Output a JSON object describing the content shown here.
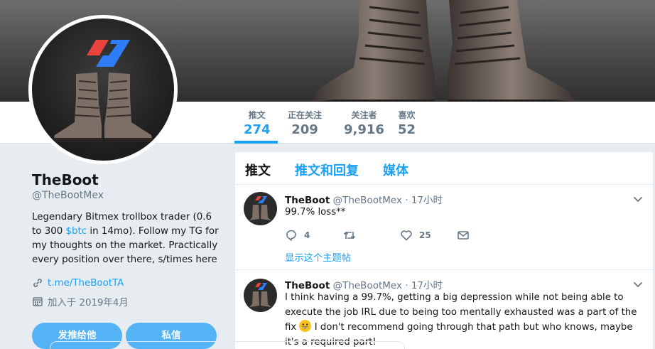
{
  "profile": {
    "name": "TheBoot",
    "handle": "@TheBootMex",
    "bio_before": "Legendary Bitmex trollbox trader (0.6 to 300 ",
    "bio_tag": "$btc",
    "bio_after": " in 14mo). Follow my TG for my thoughts on the market. Practically every position over there, s/times here",
    "link": "t.me/TheBootTA",
    "joined": "加入于 2019年4月",
    "tweet_to_label": "发推给他",
    "message_label": "私信"
  },
  "stats": [
    {
      "label": "推文",
      "value": "274"
    },
    {
      "label": "正在关注",
      "value": "209"
    },
    {
      "label": "关注者",
      "value": "9,916"
    },
    {
      "label": "喜欢",
      "value": "52"
    }
  ],
  "tabs": [
    {
      "label": "推文"
    },
    {
      "label": "推文和回复"
    },
    {
      "label": "媒体"
    }
  ],
  "tweets": [
    {
      "name": "TheBoot",
      "handle_time": "@TheBootMex · 17小时",
      "text": "99.7% loss**",
      "replies": "4",
      "retweets": "",
      "likes": "25",
      "thread_link": "显示这个主题帖"
    },
    {
      "name": "TheBoot",
      "handle_time": "@TheBootMex · 17小时",
      "text_before": "I think having a 99.7%, getting a big depression while not being able to execute the job IRL due to being too mentally exhausted was a part of the fix ",
      "text_after": " I don't recommend going through that path but who knows, maybe it's a required part!"
    }
  ],
  "colors": {
    "accent": "#1da1f2",
    "button": "#53b3f4",
    "bitmex_red": "#e8433c",
    "bitmex_blue": "#2e7cf6"
  }
}
